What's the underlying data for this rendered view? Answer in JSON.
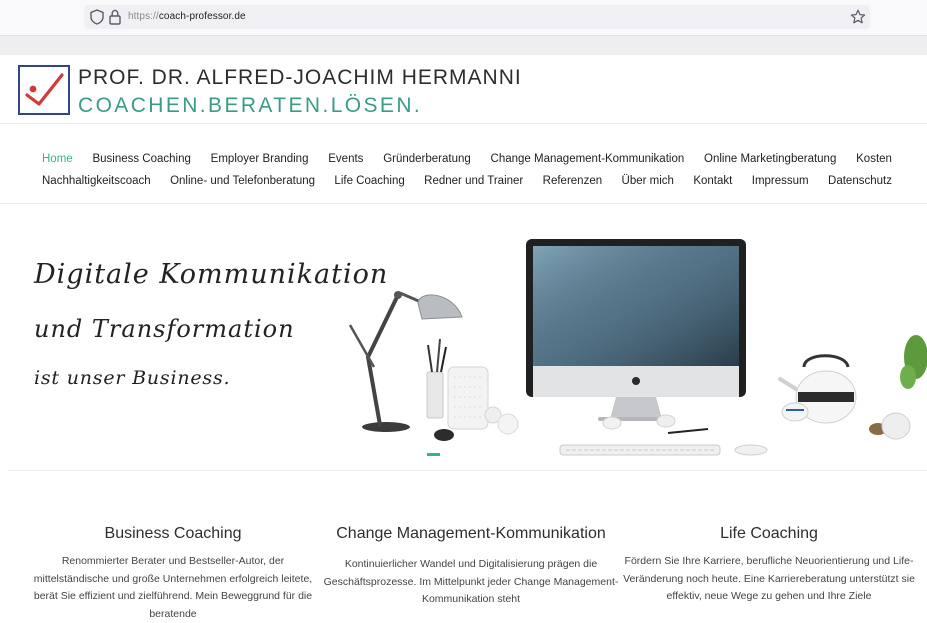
{
  "browser": {
    "url_protocol": "https://",
    "url_host": "coach-professor.de"
  },
  "header": {
    "name": "PROF. DR. ALFRED-JOACHIM HERMANNI",
    "claim": "COACHEN.BERATEN.LÖSEN."
  },
  "nav": {
    "row1": [
      "Home",
      "Business Coaching",
      "Employer Branding",
      "Events",
      "Gründerberatung",
      "Change Management-Kommunikation",
      "Online Marketingberatung",
      "Kosten"
    ],
    "row2": [
      "Nachhaltigkeitscoach",
      "Online- und Telefonberatung",
      "Life Coaching",
      "Redner und Trainer",
      "Referenzen",
      "Über mich",
      "Kontakt",
      "Impressum",
      "Datenschutz"
    ],
    "active": "Home"
  },
  "hero": {
    "line1": "Digitale Kommunikation",
    "line2": "und Transformation",
    "line3": "ist unser Business."
  },
  "services": [
    {
      "title": "Business Coaching",
      "text": "Renommierter Berater und Bestseller-Autor, der mittelständische und große Unternehmen erfolgreich leitete, berät Sie effizient und zielführend. Mein Beweggrund für die beratende"
    },
    {
      "title": "Change Management-Kommunikation",
      "text": "Kontinuierlicher Wandel und Digitalisierung prägen die Geschäftsprozesse. Im Mittelpunkt jeder Change Management-Kommunikation steht"
    },
    {
      "title": "Life Coaching",
      "text": "Fördern Sie Ihre Karriere, berufliche Neuorientierung und Life-Veränderung noch heute. Eine Karriereberatung unterstützt sie effektiv, neue Wege zu gehen und Ihre Ziele"
    }
  ],
  "colors": {
    "accent": "#3bb08f",
    "logo_border": "#31458a",
    "logo_check": "#d23a3a"
  },
  "icons": {
    "shield": "shield-icon",
    "lock": "lock-icon",
    "bookmark": "bookmark-star-icon"
  }
}
